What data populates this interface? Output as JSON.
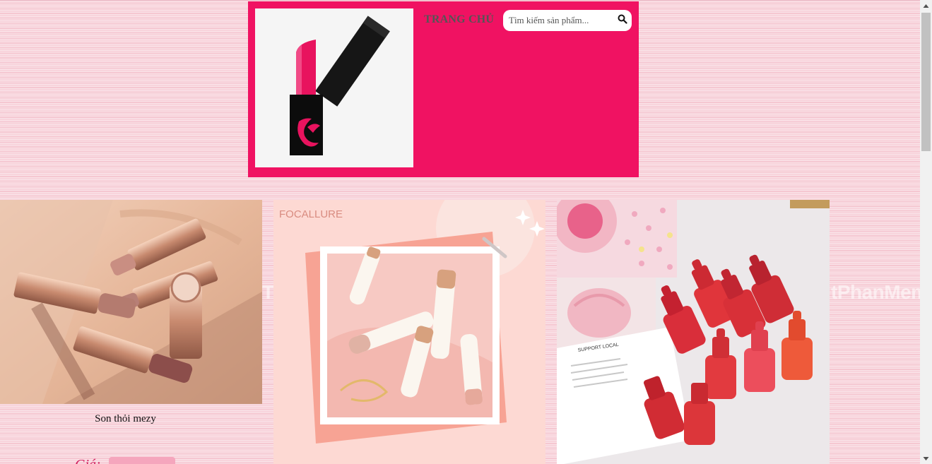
{
  "header": {
    "logo_icon": "lipstick-logo-icon",
    "nav_home_label": "TRANG CHỦ",
    "search": {
      "placeholder": "Tìm kiếm sản phẩm...",
      "value": "",
      "icon": "search-icon"
    }
  },
  "products": [
    {
      "image": "rose-gold-lipsticks-photo",
      "name": "Son thỏi mezy",
      "price_label": "Giá:"
    },
    {
      "image": "focallure-lip-tint-photo",
      "image_text": "FOCALLURE"
    },
    {
      "image": "ink-velvet-tint-bottles-photo",
      "image_text": "SUPPORT LOCAL"
    }
  ],
  "watermark": {
    "left": "T",
    "right": "tPhanMem"
  },
  "colors": {
    "header_bg": "#f01262",
    "page_bg": "#f8d4dc",
    "nav_text": "#555555",
    "price_label": "#d11a5b"
  }
}
